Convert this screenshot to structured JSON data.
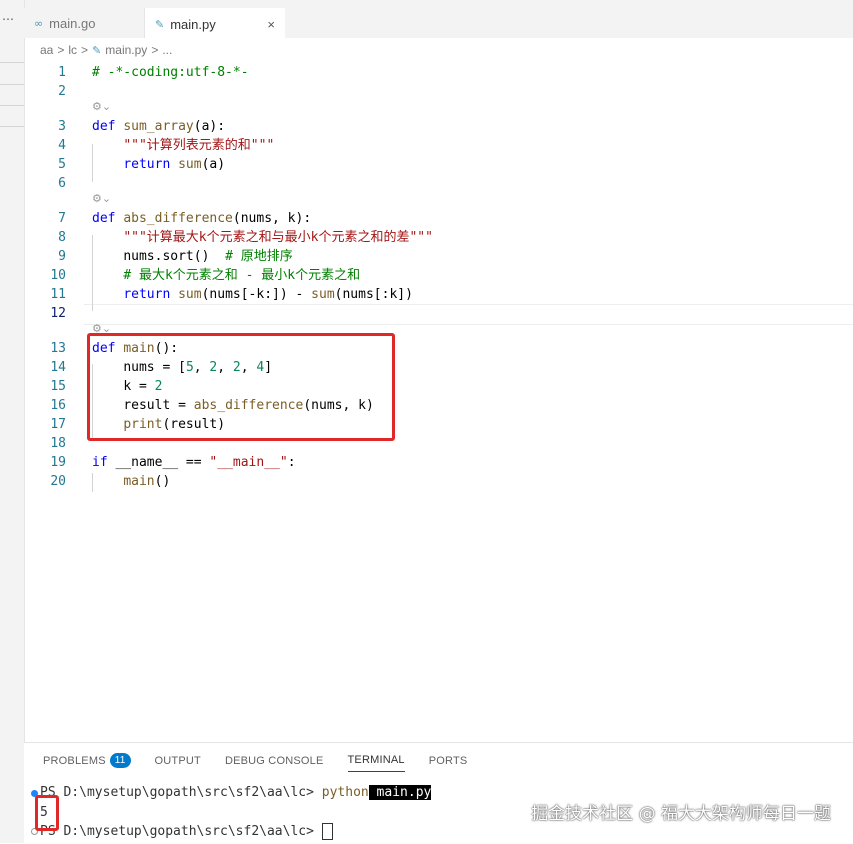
{
  "tabs": [
    {
      "label": "main.go",
      "icon": "go-file-icon"
    },
    {
      "label": "main.py",
      "icon": "python-file-icon",
      "close": "×"
    }
  ],
  "breadcrumb": [
    "aa",
    ">",
    "lc",
    ">",
    "main.py",
    ">",
    "..."
  ],
  "editor": {
    "line_numbers": [
      "1",
      "2",
      "3",
      "4",
      "5",
      "6",
      "7",
      "8",
      "9",
      "10",
      "11",
      "12",
      "13",
      "14",
      "15",
      "16",
      "17",
      "18",
      "19",
      "20"
    ],
    "code": {
      "l1": "# -*-coding:utf-8-*-",
      "l3_def": "def",
      "l3_name": "sum_array",
      "l3_rest": "(a):",
      "l4": "\"\"\"计算列表元素的和\"\"\"",
      "l5_kw": "return",
      "l5_fn": "sum",
      "l5_rest": "(a)",
      "l7_def": "def",
      "l7_name": "abs_difference",
      "l7_rest": "(nums, k):",
      "l8": "\"\"\"计算最大k个元素之和与最小k个元素之和的差\"\"\"",
      "l9_a": "nums.sort()",
      "l9_cm": "# 原地排序",
      "l10": "# 最大k个元素之和 - 最小k个元素之和",
      "l11_kw": "return",
      "l11_fn1": "sum",
      "l11_mid1": "(nums[-k:]) - ",
      "l11_fn2": "sum",
      "l11_mid2": "(nums[:k])",
      "l13_def": "def",
      "l13_name": "main",
      "l13_rest": "():",
      "l14_a": "nums = [",
      "l14_n1": "5",
      "l14_n2": "2",
      "l14_n3": "2",
      "l14_n4": "4",
      "l15_a": "k = ",
      "l15_n": "2",
      "l16_a": "result = ",
      "l16_fn": "abs_difference",
      "l16_rest": "(nums, k)",
      "l17_fn": "print",
      "l17_rest": "(result)",
      "l19_kw": "if",
      "l19_a": "__name__ == ",
      "l19_str": "\"__main__\"",
      "l19_b": ":",
      "l20_fn": "main",
      "l20_rest": "()"
    },
    "codelens": "⚙⌄"
  },
  "panel": {
    "tabs": [
      "PROBLEMS",
      "OUTPUT",
      "DEBUG CONSOLE",
      "TERMINAL",
      "PORTS"
    ],
    "problems_count": "11",
    "active_tab": "TERMINAL"
  },
  "terminal": {
    "line1_prompt": "PS D:\\mysetup\\gopath\\src\\sf2\\aa\\lc> ",
    "line1_cmd": "python",
    "line1_arg": " main.py",
    "line2_output": "5",
    "line3_prompt": "PS D:\\mysetup\\gopath\\src\\sf2\\aa\\lc> "
  },
  "watermark": "掘金技术社区 @ 福大大架构师每日一题",
  "colors": {
    "highlight_box": "#e02828",
    "badge": "#007acc"
  }
}
